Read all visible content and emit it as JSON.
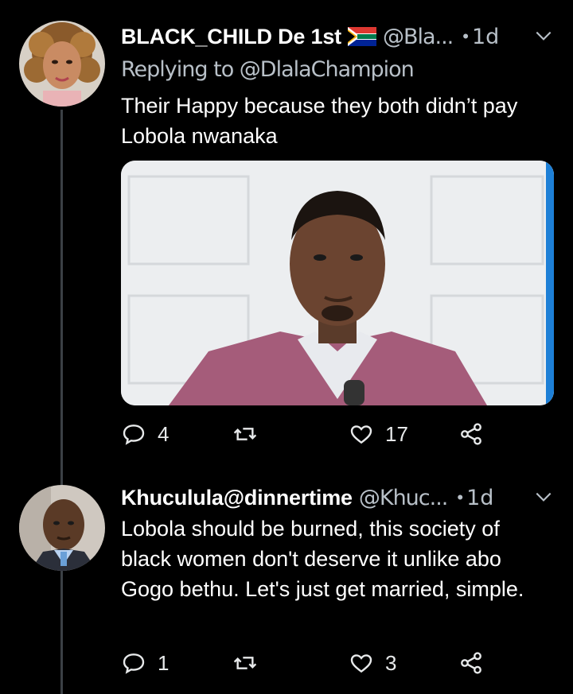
{
  "tweets": [
    {
      "name": "BLACK_CHILD De 1st",
      "handle": "@Bla...",
      "time": "1d",
      "replying_to": "Replying to @DlalaChampion",
      "text": "Their Happy because they both didn’t pay Lobola nwanaka",
      "stats": {
        "replies": "4",
        "retweets": "",
        "likes": "17"
      }
    },
    {
      "name": "Khuculula@dinnertime",
      "handle": "@Khuc...",
      "time": "1d",
      "text": "Lobola should be burned, this society  of black women don't deserve it unlike abo Gogo bethu. Let's just get married, simple.",
      "stats": {
        "replies": "1",
        "retweets": "",
        "likes": "3"
      }
    }
  ],
  "colors": {
    "background": "#000000",
    "secondary_text": "#b8c0c8",
    "thread_line": "#3b4045"
  },
  "icons": [
    "reply-icon",
    "retweet-icon",
    "like-icon",
    "share-icon",
    "chevron-down-icon",
    "south-africa-flag-icon"
  ]
}
